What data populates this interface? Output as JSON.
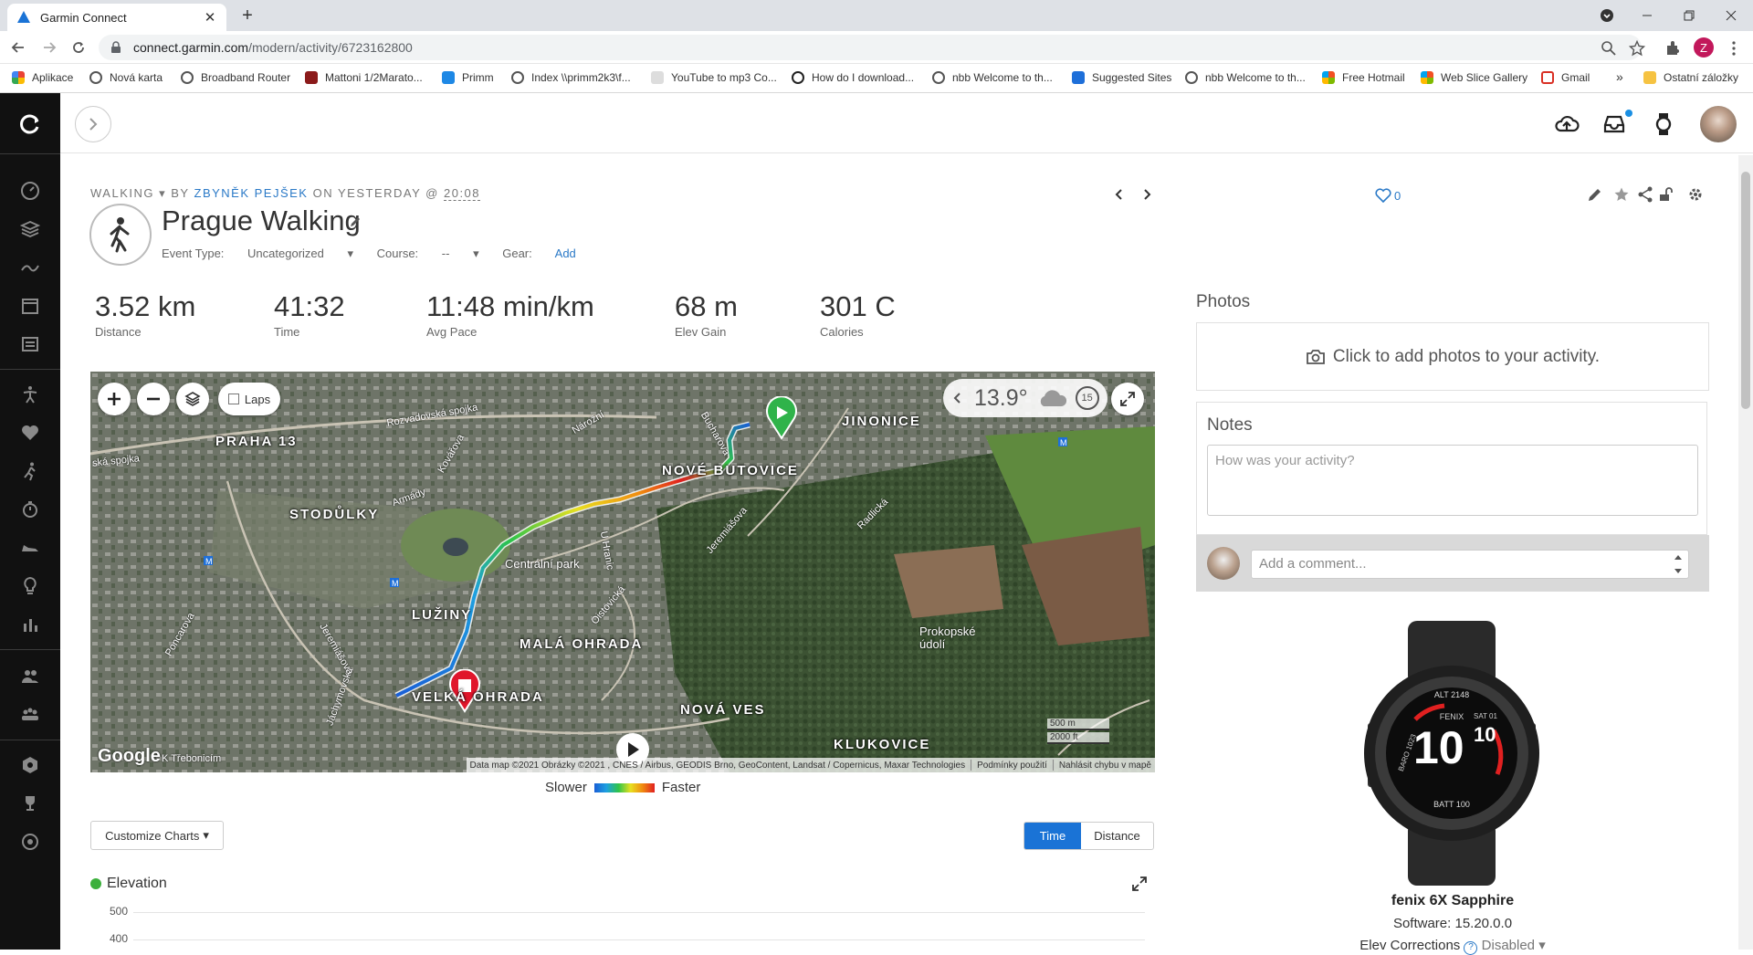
{
  "browser": {
    "tab_title": "Garmin Connect",
    "url_host": "connect.garmin.com",
    "url_path": "/modern/activity/6723162800",
    "profile_initial": "Z",
    "bookmarks": [
      "Aplikace",
      "Nová karta",
      "Broadband Router",
      "Mattoni 1/2Marato...",
      "Primm",
      "Index \\\\primm2k3\\f...",
      "YouTube to mp3 Co...",
      "How do I download...",
      "nbb Welcome to th...",
      "Suggested Sites",
      "nbb Welcome to th...",
      "Free Hotmail",
      "Web Slice Gallery",
      "Gmail"
    ],
    "bookmarks_more": "»",
    "bookmarks_folder": "Ostatní záložky"
  },
  "activity": {
    "type": "WALKING",
    "by_label": "BY",
    "author": "ZBYNĚK PEJŠEK",
    "on_label": "ON",
    "date": "YESTERDAY @",
    "time": "20:08",
    "title": "Prague Walking",
    "event_type_label": "Event Type:",
    "event_type_value": "Uncategorized",
    "course_label": "Course:",
    "course_value": "--",
    "gear_label": "Gear:",
    "gear_value": "Add",
    "likes": "0"
  },
  "stats": [
    {
      "value": "3.52 km",
      "label": "Distance"
    },
    {
      "value": "41:32",
      "label": "Time"
    },
    {
      "value": "11:48 min/km",
      "label": "Avg Pace"
    },
    {
      "value": "68 m",
      "label": "Elev Gain"
    },
    {
      "value": "301 C",
      "label": "Calories"
    }
  ],
  "map": {
    "laps_label": "Laps",
    "temperature": "13.9°",
    "wind": "15",
    "places": [
      "PRAHA 13",
      "JINONICE",
      "NOVÉ BUTOVICE",
      "STODŮLKY",
      "LUŽINY",
      "MALÁ OHRADA",
      "VELKÁ OHRADA",
      "NOVÁ VES",
      "KLUKOVICE",
      "Centrální park",
      "Prokopské údolí"
    ],
    "roads": [
      "Rozvadovská spojka",
      "ská spojka",
      "Nárožní",
      "Bucharova",
      "Armády",
      "Kovářova",
      "Radlická",
      "Jeremiášova",
      "U Hranic",
      "Poncarova",
      "Jáchymovská",
      "Jeremiášova",
      "Oistovická",
      "K Třebonicím"
    ],
    "google": "Google",
    "attribution": "Data map ©2021 Obrázky ©2021 , CNES / Airbus, GEODIS Brno, GeoContent, Landsat / Copernicus, Maxar Technologies",
    "terms": "Podmínky použití",
    "report": "Nahlásit chybu v mapě",
    "scale_m": "500 m",
    "scale_ft": "2000 ft",
    "legend_slow": "Slower",
    "legend_fast": "Faster"
  },
  "charts": {
    "customize_label": "Customize Charts",
    "toggle": [
      "Time",
      "Distance"
    ],
    "toggle_active": "Time",
    "elevation_label": "Elevation",
    "y_ticks": [
      "500",
      "400"
    ]
  },
  "sidebar_right": {
    "photos_title": "Photos",
    "photos_cta": "Click to add photos to your activity.",
    "notes_title": "Notes",
    "notes_placeholder": "How was your activity?",
    "comment_placeholder": "Add a comment...",
    "device_name": "fenix 6X Sapphire",
    "software": "Software: 15.20.0.0",
    "elev_corrections_label": "Elev Corrections",
    "elev_corrections_value": "Disabled"
  },
  "watch_face": {
    "time": "10",
    "secondary": "10",
    "brand": "FENIX",
    "top": "ALT 2148",
    "bottom": "BATT 100",
    "left": "BARO 1023",
    "right": "SAT 01"
  },
  "colors": {
    "accent": "#1a73d6",
    "link": "#2a79c7",
    "start": "#2fb34a",
    "end": "#e0162b"
  }
}
